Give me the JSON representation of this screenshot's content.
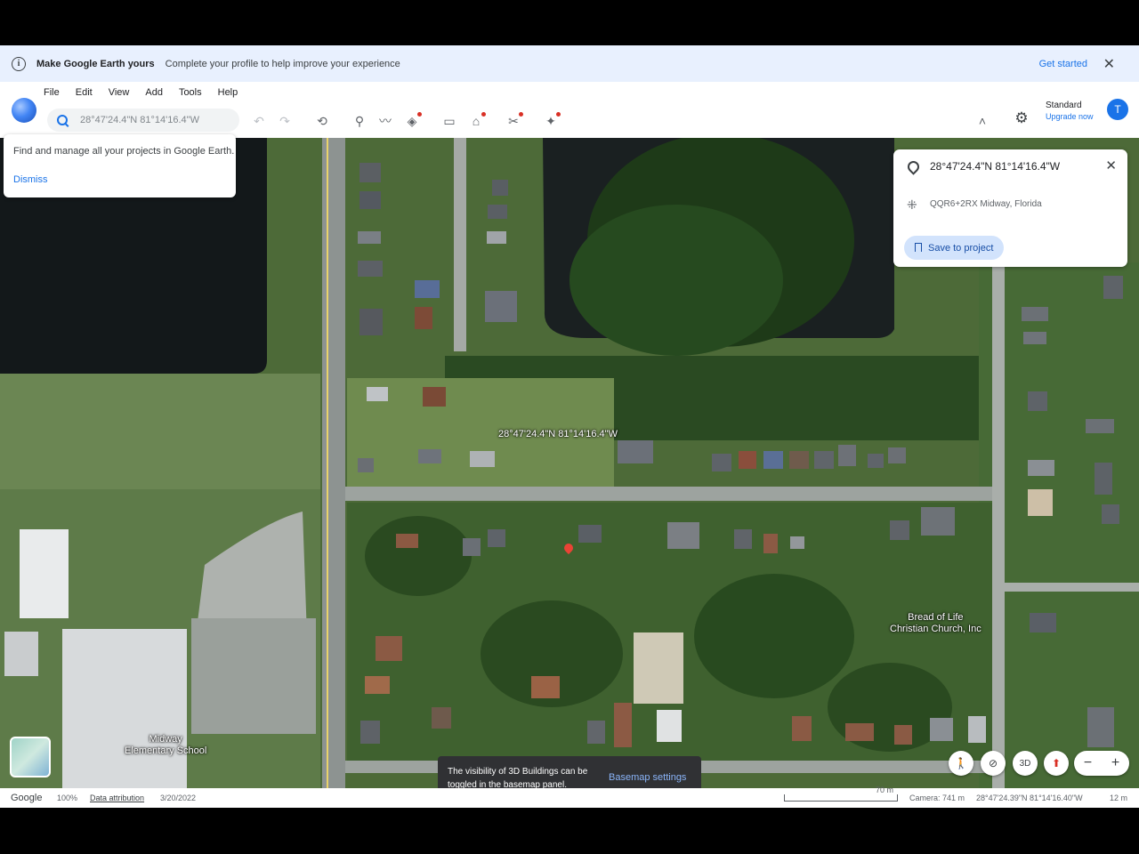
{
  "banner": {
    "title": "Make Google Earth yours",
    "message": "Complete your profile to help improve your experience",
    "action": "Get started",
    "close": "✕"
  },
  "menu": [
    "File",
    "Edit",
    "View",
    "Add",
    "Tools",
    "Help"
  ],
  "search": {
    "placeholder": "28°47'24.4\"N 81°14'16.4\"W"
  },
  "toolbar": {
    "undo": "↶",
    "redo": "↷",
    "history": "⟲",
    "placemark": "⚲",
    "path": "〰",
    "layers": "◈",
    "measure": "▭",
    "data": "⌂",
    "tools": "✂",
    "gemini": "✦",
    "collapse": "˄"
  },
  "account": {
    "plan": "Standard",
    "upgrade": "Upgrade now",
    "avatar": "T"
  },
  "projects_card": {
    "text": "Find and manage all your projects in Google Earth.",
    "dismiss": "Dismiss"
  },
  "place_card": {
    "coordinates": "28°47'24.4\"N 81°14'16.4\"W",
    "plus_code": "QQR6+2RX Midway, Florida",
    "save": "Save to project",
    "close": "✕"
  },
  "map_labels": {
    "marker": "28°47'24.4\"N 81°14'16.4\"W",
    "church": "Bread of Life\nChristian Church, Inc",
    "school": "Midway\nElementary School"
  },
  "controls": {
    "person": "🚶",
    "no_tilt": "⊘",
    "three_d": "3D",
    "compass": "⬆",
    "zoom_out": "−",
    "zoom_in": "+"
  },
  "toast": {
    "message": "The visibility of 3D Buildings can be toggled in the basemap panel.",
    "action": "Basemap settings"
  },
  "status": {
    "brand": "Google",
    "zoom": "100%",
    "attribution": "Data attribution",
    "date": "3/20/2022",
    "scale": "70 m",
    "camera": "Camera: 741 m",
    "cursor": "28°47'24.39\"N 81°14'16.40\"W",
    "elevation": "12 m"
  }
}
